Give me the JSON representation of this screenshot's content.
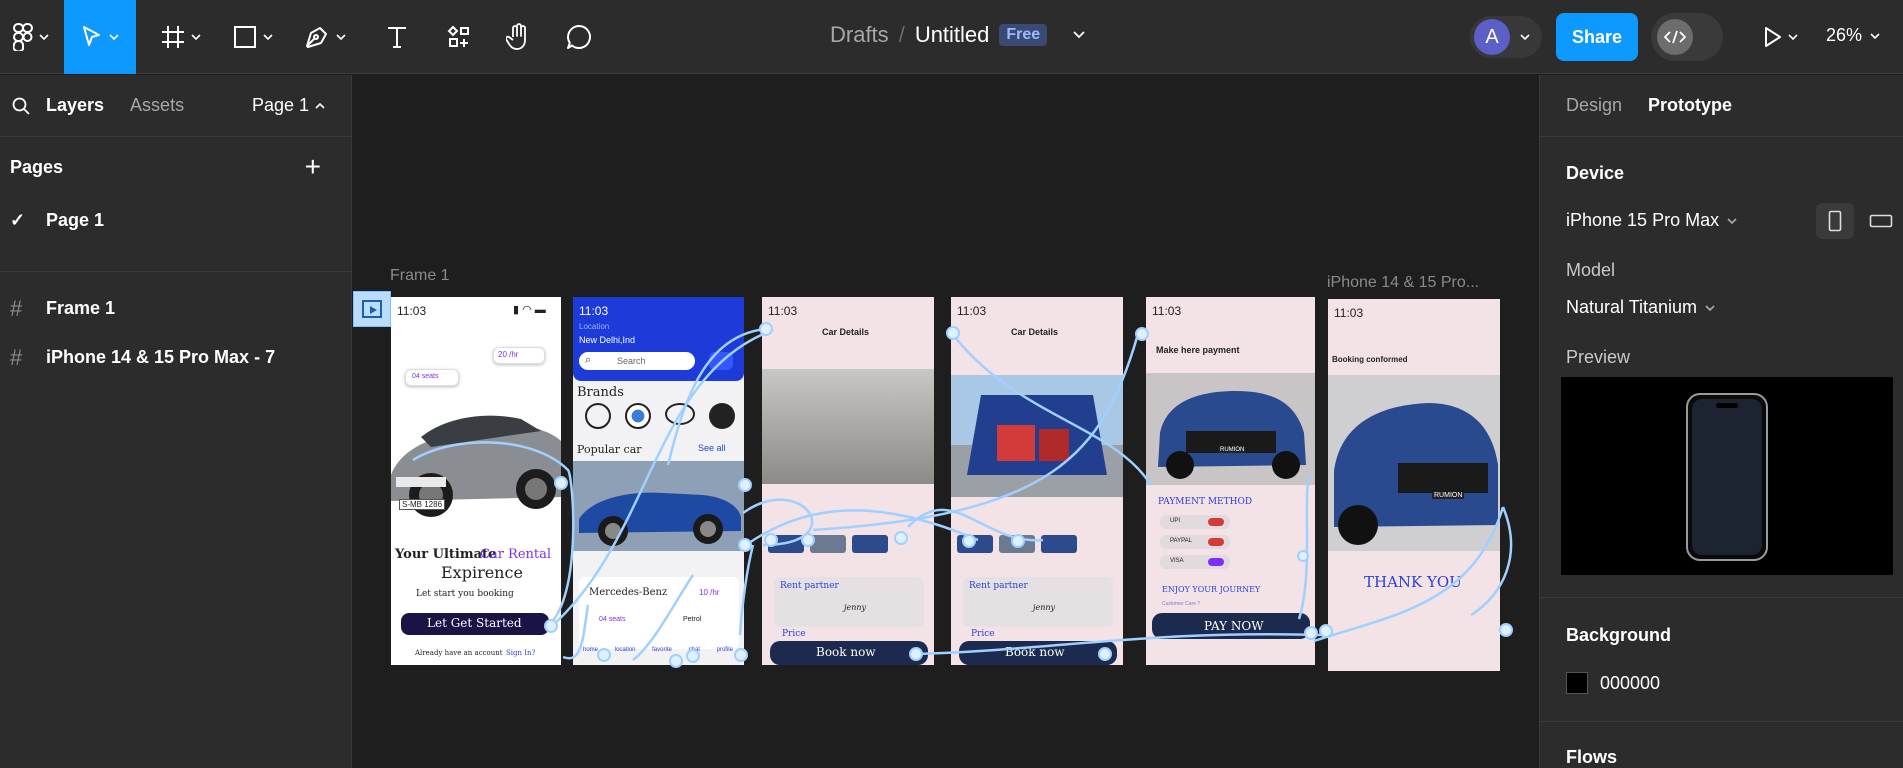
{
  "toolbar": {
    "doc_drafts": "Drafts",
    "doc_slash": "/",
    "doc_name": "Untitled",
    "plan_badge": "Free",
    "avatar_initial": "A",
    "share_label": "Share",
    "zoom": "26%"
  },
  "left_panel": {
    "tab_layers": "Layers",
    "tab_assets": "Assets",
    "page_selector": "Page 1",
    "pages_title": "Pages",
    "pages": [
      {
        "label": "Page 1",
        "selected": true
      }
    ],
    "layers": [
      {
        "label": "Frame 1"
      },
      {
        "label": "iPhone 14 & 15 Pro Max - 7"
      }
    ]
  },
  "canvas": {
    "frame1_label": "Frame 1",
    "frame7_label": "iPhone 14 & 15 Pro...",
    "screen1": {
      "time": "11:03",
      "seats": "04 seats",
      "rate": "20 /hr",
      "plate": "S-MB 1286",
      "headline_1": "Your Ultimate",
      "headline_accent": "Car Rental",
      "headline_2": "Expirence",
      "sub": "Let start you booking",
      "cta": "Let Get Started",
      "footer_a": "Already have an account",
      "footer_b": "Sign In?"
    },
    "screen2": {
      "time": "11:03",
      "location_label": "Location",
      "location_value": "New Delhi,Ind",
      "search_placeholder": "Search",
      "brands": "Brands",
      "popular": "Popular car",
      "see_all": "See all",
      "car_name": "Mercedes-Benz",
      "rate": "10 /hr",
      "seats": "04 seats",
      "fuel": "Petrol",
      "nav": [
        "home",
        "location",
        "favorite",
        "chat",
        "profile"
      ]
    },
    "screen3": {
      "time": "11:03",
      "title": "Car Details",
      "partner": "Rent partner",
      "partner_name": "jenny",
      "price": "Price",
      "cta": "Book now"
    },
    "screen4": {
      "time": "11:03",
      "title": "Car Details",
      "partner": "Rent partner",
      "partner_name": "jenny",
      "price": "Price",
      "cta": "Book now"
    },
    "screen5": {
      "time": "11:03",
      "title": "Make here payment",
      "plate": "RUMION",
      "method": "PAYMENT METHOD",
      "options": [
        "UPI",
        "PAYPAL",
        "VISA"
      ],
      "enjoy": "ENJOY YOUR JOURNEY",
      "customer": "Customer Care ?",
      "cta": "PAY NOW"
    },
    "screen6": {
      "time": "11:03",
      "title": "Booking conformed",
      "plate": "RUMION",
      "thanks": "THANK YOU"
    }
  },
  "right_panel": {
    "tab_design": "Design",
    "tab_prototype": "Prototype",
    "device_title": "Device",
    "device_value": "iPhone 15 Pro Max",
    "model_label": "Model",
    "model_value": "Natural Titanium",
    "preview_label": "Preview",
    "background_title": "Background",
    "background_value": "000000",
    "flows_title": "Flows"
  },
  "colors": {
    "accent": "#0d99ff",
    "connector": "#9fd0ff",
    "navy_button": "#1b2a4e",
    "brand_blue": "#1d3bd9",
    "purple": "#7b2ff7"
  }
}
